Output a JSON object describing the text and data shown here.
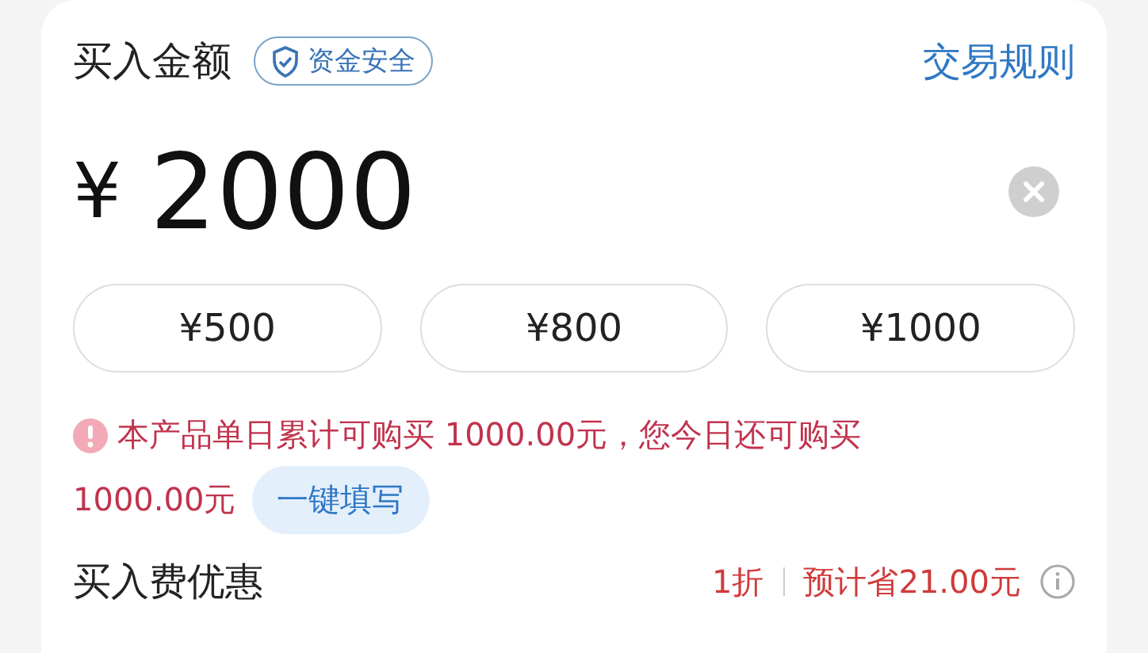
{
  "header": {
    "title": "买入金额",
    "badge": "资金安全",
    "link": "交易规则"
  },
  "amount": {
    "currency": "¥",
    "value": "2000"
  },
  "quick_amounts": [
    {
      "label": "¥500",
      "selected": false
    },
    {
      "label": "¥800",
      "selected": false
    },
    {
      "label": "¥1000",
      "selected": false
    }
  ],
  "notice": {
    "lines": [
      "本产品单日累计可购买 1000.00元，您今日还可购买",
      "1000.00元"
    ],
    "button": "一键填写"
  },
  "fee": {
    "label": "买入费优惠",
    "discount": "1折",
    "saving": "预计省21.00元"
  }
}
